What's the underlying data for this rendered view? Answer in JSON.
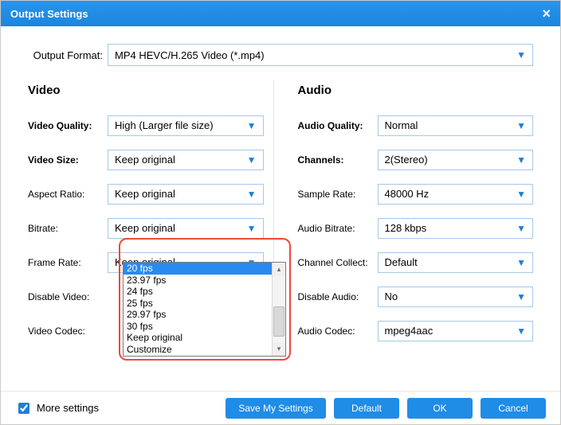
{
  "title": "Output Settings",
  "output_format": {
    "label": "Output Format:",
    "value": "MP4 HEVC/H.265 Video (*.mp4)"
  },
  "video": {
    "section_title": "Video",
    "quality": {
      "label": "Video Quality:",
      "value": "High (Larger file size)"
    },
    "size": {
      "label": "Video Size:",
      "value": "Keep original"
    },
    "aspect": {
      "label": "Aspect Ratio:",
      "value": "Keep original"
    },
    "bitrate": {
      "label": "Bitrate:",
      "value": "Keep original"
    },
    "framerate": {
      "label": "Frame Rate:",
      "value": "Keep original"
    },
    "disable": {
      "label": "Disable Video:",
      "value": ""
    },
    "codec": {
      "label": "Video Codec:",
      "value": ""
    },
    "framerate_options": {
      "selected_index": 0,
      "items": [
        "20 fps",
        "23.97 fps",
        "24 fps",
        "25 fps",
        "29.97 fps",
        "30 fps",
        "Keep original",
        "Customize"
      ]
    }
  },
  "audio": {
    "section_title": "Audio",
    "quality": {
      "label": "Audio Quality:",
      "value": "Normal"
    },
    "channels": {
      "label": "Channels:",
      "value": "2(Stereo)"
    },
    "samplerate": {
      "label": "Sample Rate:",
      "value": "48000 Hz"
    },
    "bitrate": {
      "label": "Audio Bitrate:",
      "value": "128 kbps"
    },
    "collect": {
      "label": "Channel Collect:",
      "value": "Default"
    },
    "disable": {
      "label": "Disable Audio:",
      "value": "No"
    },
    "codec": {
      "label": "Audio Codec:",
      "value": "mpeg4aac"
    }
  },
  "footer": {
    "more_settings": "More settings",
    "save": "Save My Settings",
    "default": "Default",
    "ok": "OK",
    "cancel": "Cancel"
  }
}
